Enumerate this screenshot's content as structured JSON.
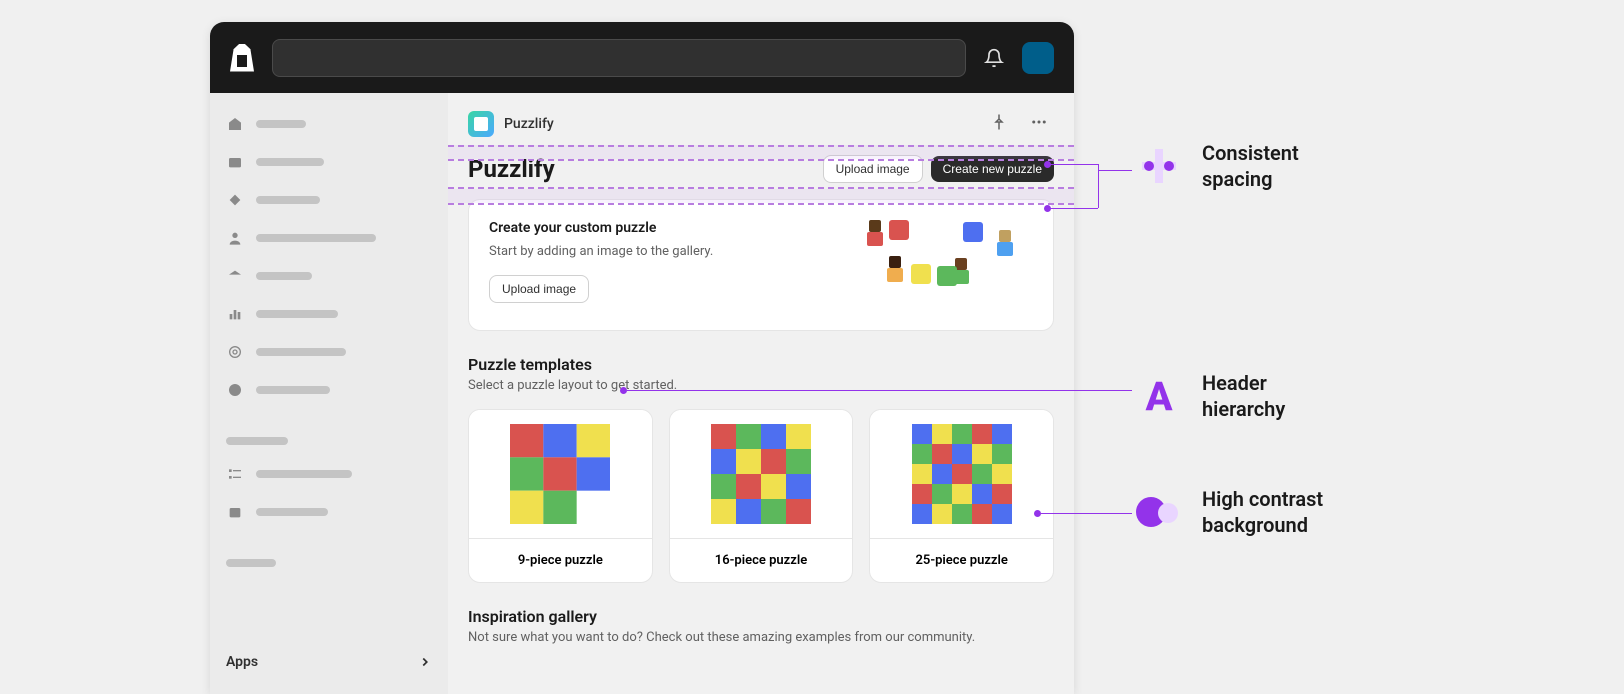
{
  "app": {
    "name": "Puzzlify",
    "page_title": "Puzzlify"
  },
  "actions": {
    "upload_secondary": "Upload image",
    "create_primary": "Create new puzzle"
  },
  "create_card": {
    "title": "Create your custom puzzle",
    "desc": "Start by adding an image to the gallery.",
    "button": "Upload image"
  },
  "templates": {
    "title": "Puzzle templates",
    "desc": "Select a puzzle layout to get started.",
    "items": [
      {
        "label": "9-piece puzzle"
      },
      {
        "label": "16-piece puzzle"
      },
      {
        "label": "25-piece puzzle"
      }
    ]
  },
  "gallery": {
    "title": "Inspiration gallery",
    "desc": "Not sure what you want to do? Check out these amazing examples from our community."
  },
  "sidebar": {
    "apps_label": "Apps"
  },
  "annotations": {
    "spacing": "Consistent spacing",
    "hierarchy": "Header hierarchy",
    "contrast": "High contrast background"
  }
}
